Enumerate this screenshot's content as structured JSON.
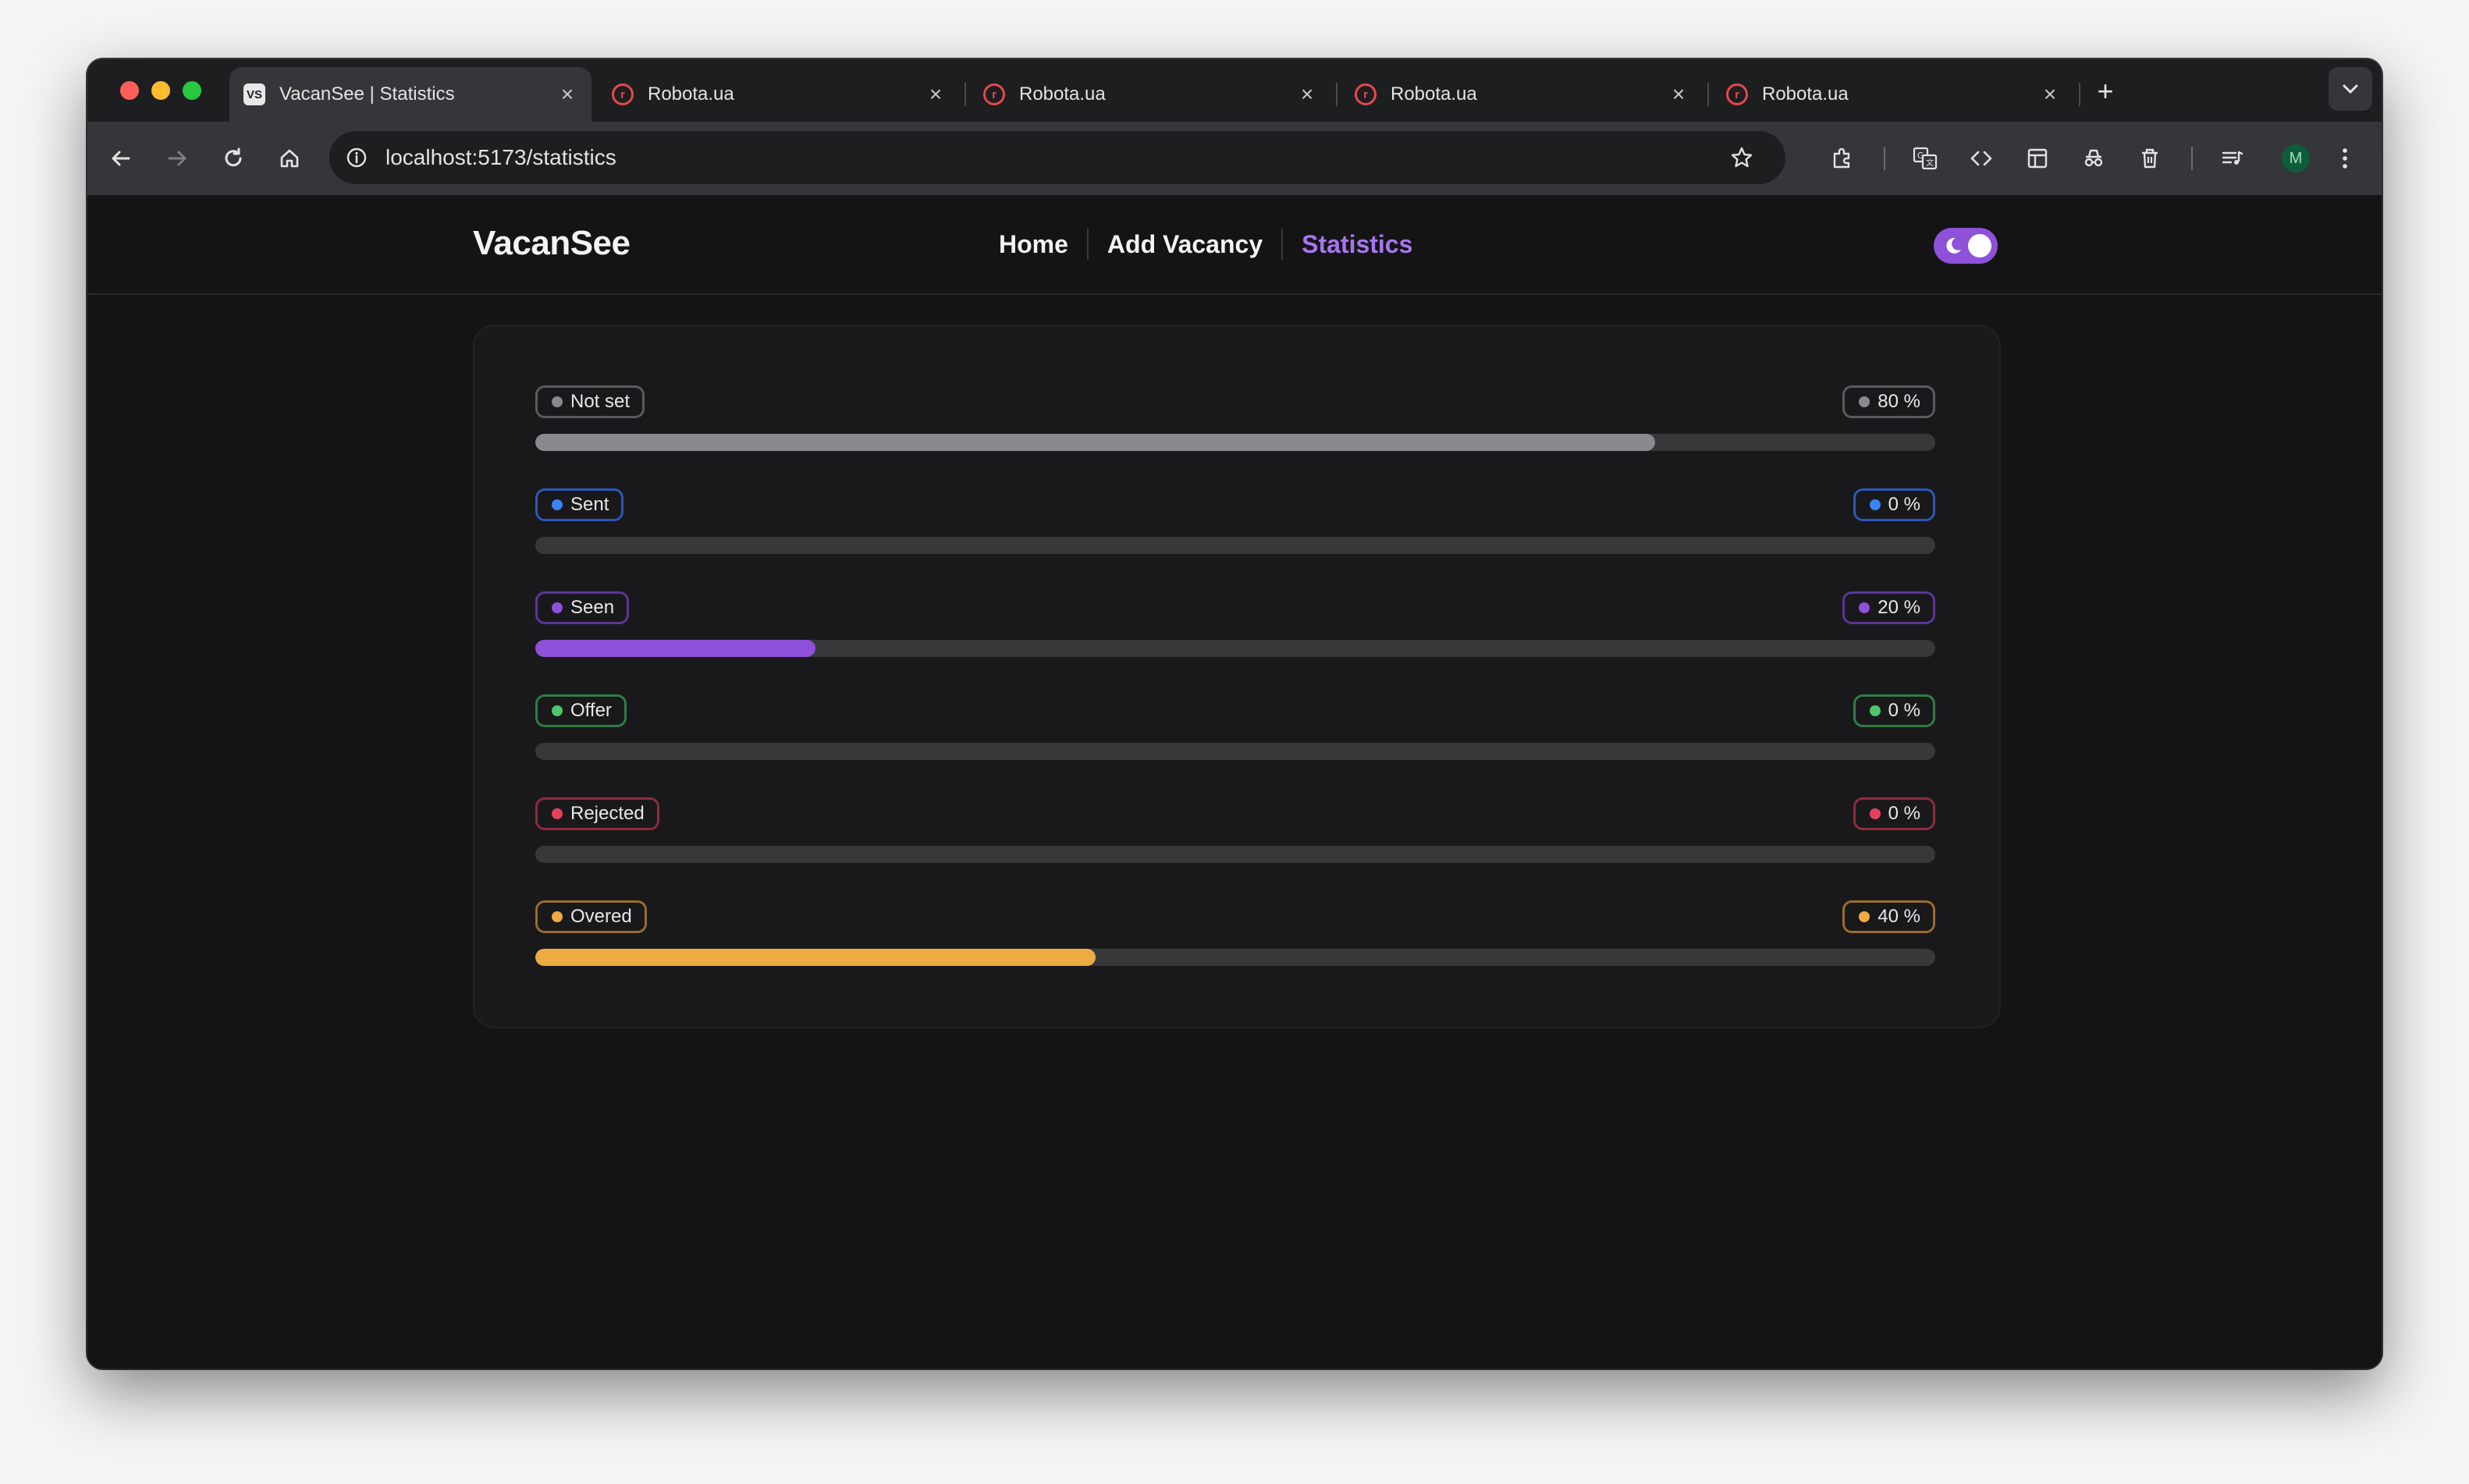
{
  "browser": {
    "tabs": [
      {
        "title": "VacanSee | Statistics",
        "favicon": "VS",
        "active": true
      },
      {
        "title": "Robota.ua",
        "favicon": "r",
        "active": false
      },
      {
        "title": "Robota.ua",
        "favicon": "r",
        "active": false
      },
      {
        "title": "Robota.ua",
        "favicon": "r",
        "active": false
      },
      {
        "title": "Robota.ua",
        "favicon": "r",
        "active": false
      }
    ],
    "url": "localhost:5173/statistics",
    "avatar_initial": "M"
  },
  "app": {
    "brand": "VacanSee",
    "nav": [
      {
        "label": "Home",
        "active": false
      },
      {
        "label": "Add Vacancy",
        "active": false
      },
      {
        "label": "Statistics",
        "active": true
      }
    ],
    "theme_toggle_on": true,
    "accent_color": "#a775f2"
  },
  "statistics": [
    {
      "label": "Not set",
      "percent": 80,
      "percent_label": "80 %",
      "color": "#8a8a8e",
      "border": "#5a5a5e"
    },
    {
      "label": "Sent",
      "percent": 0,
      "percent_label": "0 %",
      "color": "#3b82f6",
      "border": "#2f56b8"
    },
    {
      "label": "Seen",
      "percent": 20,
      "percent_label": "20 %",
      "color": "#8e51d9",
      "border": "#5a3598"
    },
    {
      "label": "Offer",
      "percent": 0,
      "percent_label": "0 %",
      "color": "#4ec56a",
      "border": "#2f7d45"
    },
    {
      "label": "Rejected",
      "percent": 0,
      "percent_label": "0 %",
      "color": "#e5415d",
      "border": "#8e2b3e"
    },
    {
      "label": "Overed",
      "percent": 40,
      "percent_label": "40 %",
      "color": "#efab43",
      "border": "#9a6c2c"
    }
  ]
}
